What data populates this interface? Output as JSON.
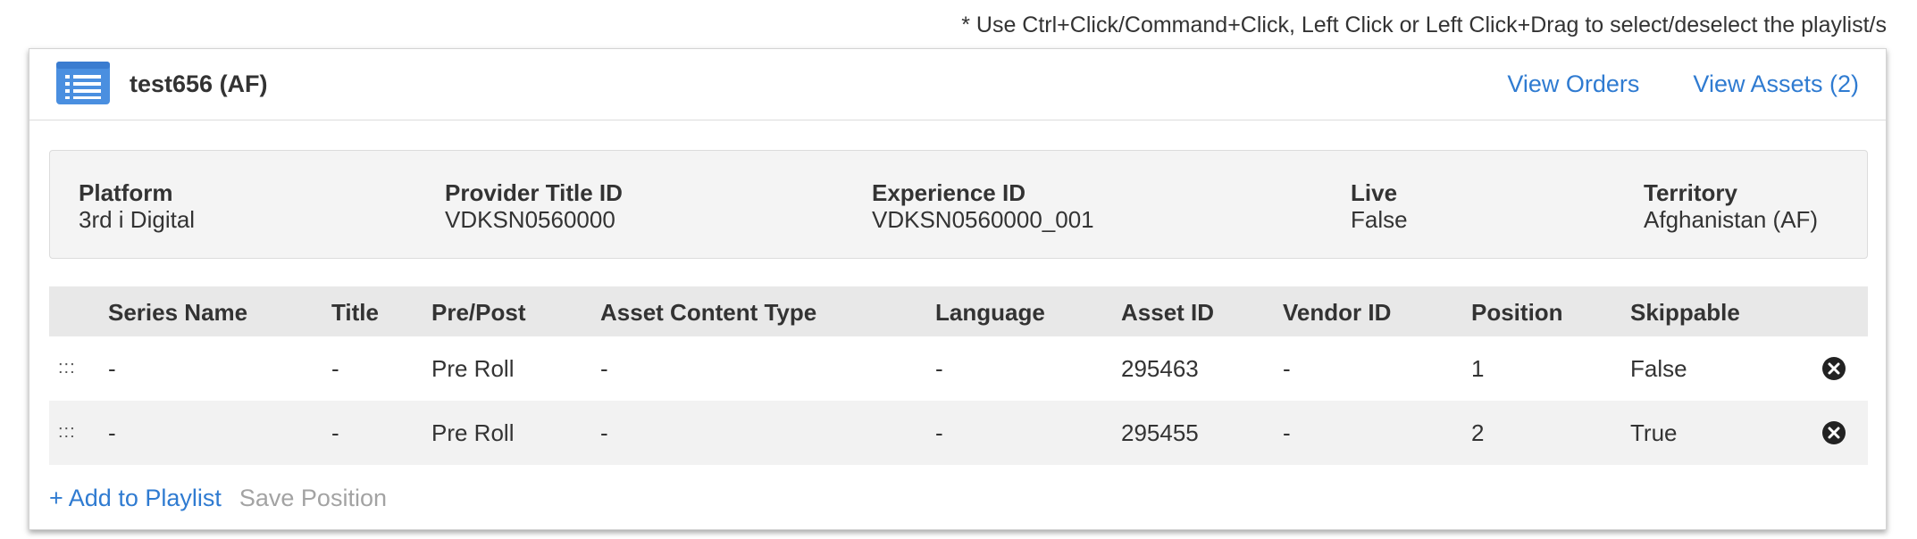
{
  "hint": "* Use Ctrl+Click/Command+Click, Left Click or Left Click+Drag to select/deselect the playlist/s",
  "playlist": {
    "title": "test656 (AF)",
    "icon": "list-icon",
    "links": {
      "view_orders": "View Orders",
      "view_assets": "View Assets (2)"
    }
  },
  "info": {
    "platform_label": "Platform",
    "platform_value": "3rd i Digital",
    "provider_label": "Provider Title ID",
    "provider_value": "VDKSN0560000",
    "experience_label": "Experience ID",
    "experience_value": "VDKSN0560000_001",
    "live_label": "Live",
    "live_value": "False",
    "territory_label": "Territory",
    "territory_value": "Afghanistan (AF)"
  },
  "table": {
    "headers": {
      "series_name": "Series Name",
      "title": "Title",
      "pre_post": "Pre/Post",
      "content_type": "Asset Content Type",
      "language": "Language",
      "asset_id": "Asset ID",
      "vendor_id": "Vendor ID",
      "position": "Position",
      "skippable": "Skippable"
    },
    "rows": [
      {
        "drag": ":::",
        "series_name": "-",
        "title": "-",
        "pre_post": "Pre Roll",
        "content_type": "-",
        "language": "-",
        "asset_id": "295463",
        "vendor_id": "-",
        "position": "1",
        "skippable": "False"
      },
      {
        "drag": ":::",
        "series_name": "-",
        "title": "-",
        "pre_post": "Pre Roll",
        "content_type": "-",
        "language": "-",
        "asset_id": "295455",
        "vendor_id": "-",
        "position": "2",
        "skippable": "True"
      }
    ]
  },
  "footer": {
    "add_label": "+ Add to Playlist",
    "save_label": "Save Position"
  },
  "colors": {
    "link": "#2f7bd1",
    "icon": "#4a8fe0",
    "disabled": "#a3a3a3"
  }
}
